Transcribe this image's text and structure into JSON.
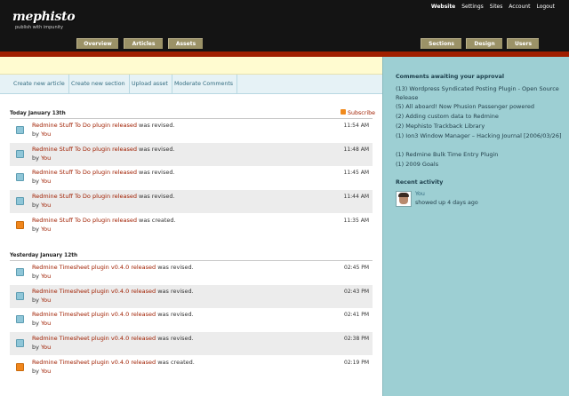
{
  "header": {
    "logo_title": "mephisto",
    "logo_tagline": "publish with impunity",
    "top_links": [
      "Website",
      "Settings",
      "Sites",
      "Account",
      "Logout"
    ],
    "left_tabs": [
      "Overview",
      "Articles",
      "Assets"
    ],
    "right_tabs": [
      "Sections",
      "Design",
      "Users"
    ]
  },
  "subnav": [
    "Create new article",
    "Create new section",
    "Upload asset",
    "Moderate Comments"
  ],
  "activity": {
    "subscribe_label": "Subscribe",
    "groups": [
      {
        "heading": "Today January 13th",
        "items": [
          {
            "title": "Redmine Stuff To Do plugin released",
            "action": "was revised.",
            "by": "by",
            "author": "You",
            "time": "11:54 AM",
            "icon": "edit-icon"
          },
          {
            "title": "Redmine Stuff To Do plugin released",
            "action": "was revised.",
            "by": "by",
            "author": "You",
            "time": "11:48 AM",
            "icon": "edit-icon"
          },
          {
            "title": "Redmine Stuff To Do plugin released",
            "action": "was revised.",
            "by": "by",
            "author": "You",
            "time": "11:45 AM",
            "icon": "edit-icon"
          },
          {
            "title": "Redmine Stuff To Do plugin released",
            "action": "was revised.",
            "by": "by",
            "author": "You",
            "time": "11:44 AM",
            "icon": "edit-icon"
          },
          {
            "title": "Redmine Stuff To Do plugin released",
            "action": "was created.",
            "by": "by",
            "author": "You",
            "time": "11:35 AM",
            "icon": "new-article-icon"
          }
        ]
      },
      {
        "heading": "Yesterday January 12th",
        "items": [
          {
            "title": "Redmine Timesheet plugin v0.4.0 released",
            "action": "was revised.",
            "by": "by",
            "author": "You",
            "time": "02:45 PM",
            "icon": "edit-icon"
          },
          {
            "title": "Redmine Timesheet plugin v0.4.0 released",
            "action": "was revised.",
            "by": "by",
            "author": "You",
            "time": "02:43 PM",
            "icon": "edit-icon"
          },
          {
            "title": "Redmine Timesheet plugin v0.4.0 released",
            "action": "was revised.",
            "by": "by",
            "author": "You",
            "time": "02:41 PM",
            "icon": "edit-icon"
          },
          {
            "title": "Redmine Timesheet plugin v0.4.0 released",
            "action": "was revised.",
            "by": "by",
            "author": "You",
            "time": "02:38 PM",
            "icon": "edit-icon"
          },
          {
            "title": "Redmine Timesheet plugin v0.4.0 released",
            "action": "was created.",
            "by": "by",
            "author": "You",
            "time": "02:19 PM",
            "icon": "new-article-icon"
          }
        ]
      }
    ]
  },
  "sidebar": {
    "approval_heading": "Comments awaiting your approval",
    "approvals": [
      {
        "count": "(13)",
        "title": "Wordpress Syndicated Posting Plugin - Open Source Release"
      },
      {
        "count": "(5)",
        "title": "All aboard! Now Phusion Passenger powered"
      },
      {
        "count": "(2)",
        "title": "Adding custom data to Redmine"
      },
      {
        "count": "(2)",
        "title": "Mephisto Trackback Library"
      },
      {
        "count": "(1)",
        "title": "Ion3 Window Manager – Hacking Journal [2006/03/26]"
      },
      {
        "count": "(1)",
        "title": "Redmine Bulk Time Entry Plugin"
      },
      {
        "count": "(1)",
        "title": "2009 Goals"
      }
    ],
    "recent_heading": "Recent activity",
    "recent_user": "You",
    "recent_text": "showed up 4 days ago"
  },
  "colors": {
    "header_bg": "#141414",
    "tab_bg": "#9b9267",
    "accent_red": "#a01f00",
    "sidebar_bg": "#9dcfd3",
    "notice_bg": "#fffbd0"
  }
}
